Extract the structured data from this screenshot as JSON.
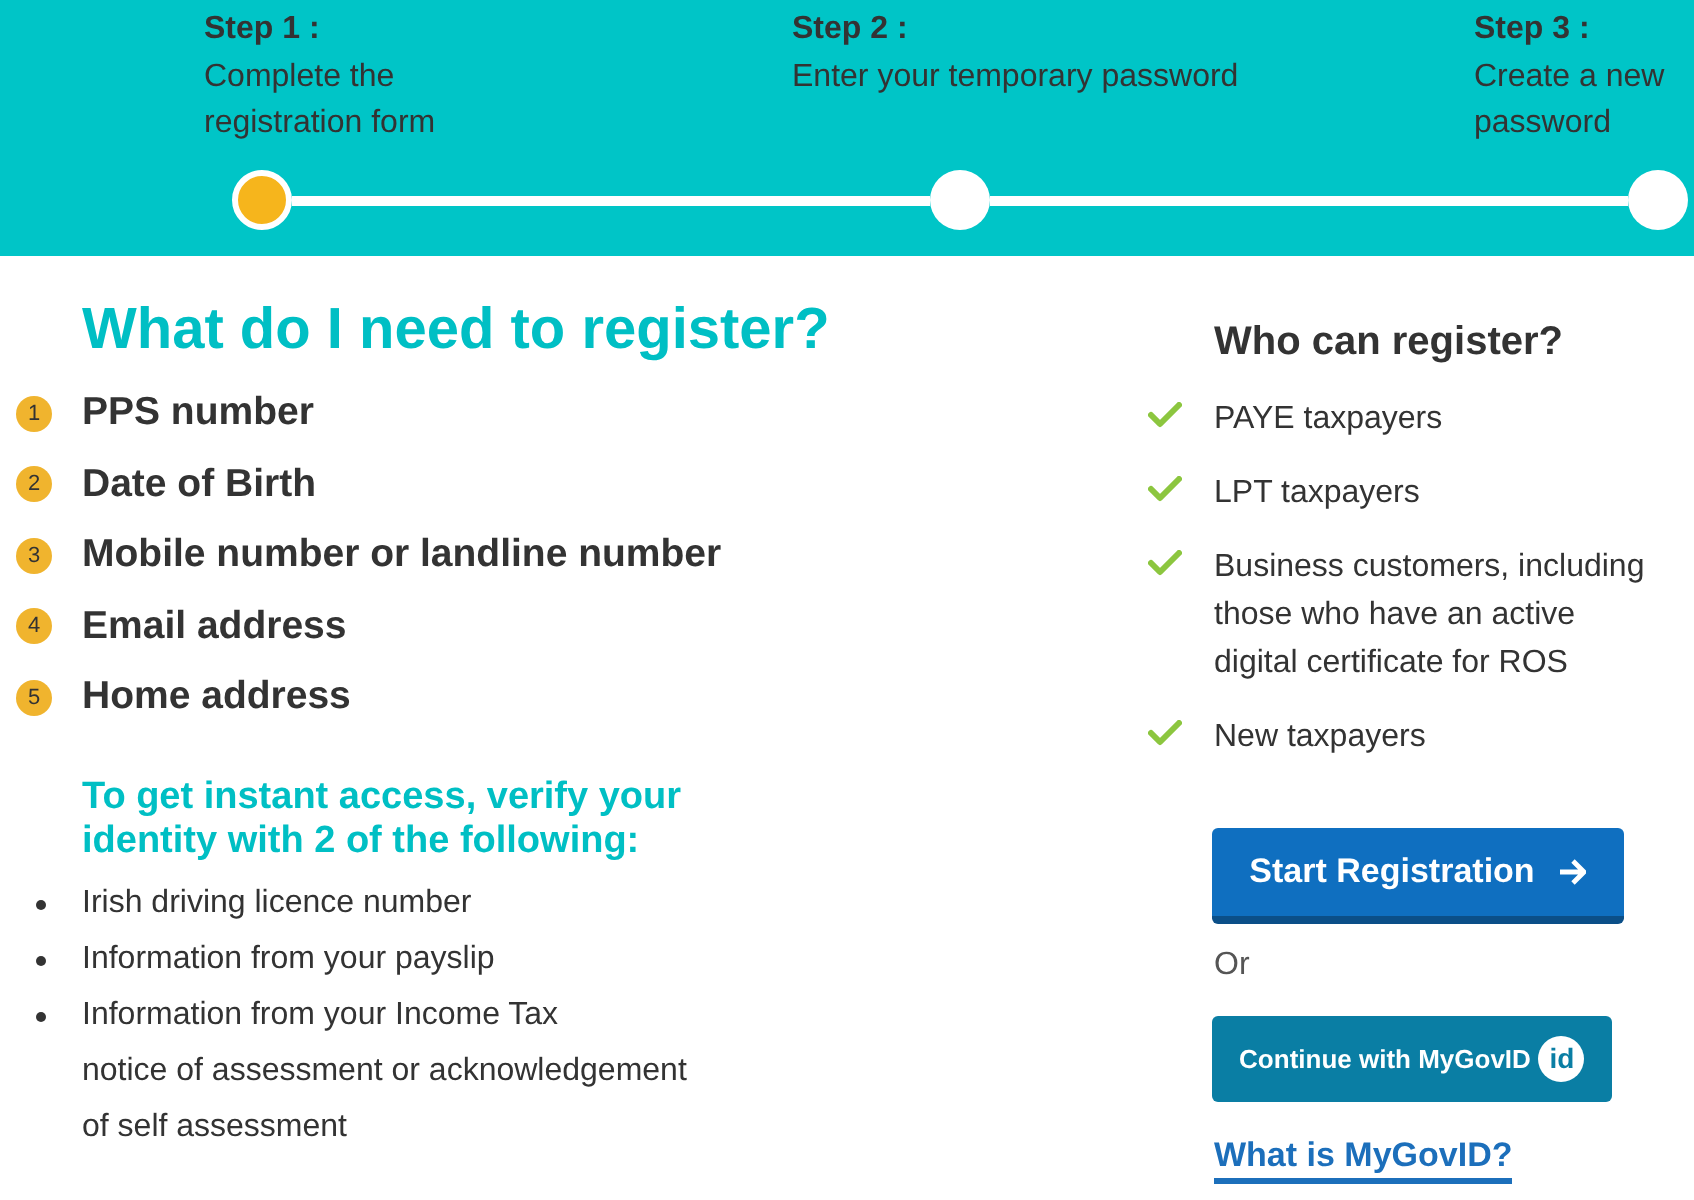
{
  "progress": {
    "steps": [
      {
        "label": "Step 1 :",
        "description": "Complete the\nregistration form",
        "selected": true
      },
      {
        "label": "Step 2 :",
        "description": "Enter your temporary password",
        "selected": false
      },
      {
        "label": "Step 3 :",
        "description": "Create a new\npassword",
        "selected": false
      }
    ]
  },
  "requirements": {
    "title": "What do I need to register?",
    "items": [
      {
        "number": "1",
        "text": "PPS number"
      },
      {
        "number": "2",
        "text": "Date of Birth"
      },
      {
        "number": "3",
        "text": "Mobile number or landline number"
      },
      {
        "number": "4",
        "text": "Email address"
      },
      {
        "number": "5",
        "text": "Home address"
      }
    ]
  },
  "verification": {
    "title": "To get instant access, verify your identity with 2 of the following:",
    "items": [
      "Irish driving licence number",
      "Information from your payslip",
      "Information from your Income Tax\nnotice of assessment or acknowledgement\nof self assessment"
    ]
  },
  "eligibility": {
    "title": "Who can register?",
    "items": [
      "PAYE taxpayers",
      "LPT taxpayers",
      "Business customers, including\nthose who have an active\ndigital certificate for ROS",
      "New taxpayers"
    ]
  },
  "actions": {
    "start_button": "Start Registration",
    "separator": "Or",
    "mygovid_button": {
      "label": "Continue with MyGovID",
      "logo_text": "id"
    },
    "info_link": "What is MyGovID?"
  }
}
